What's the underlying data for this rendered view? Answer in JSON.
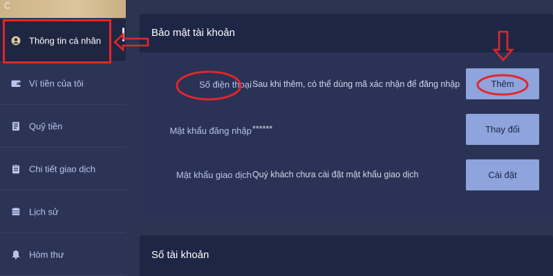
{
  "sidebar": {
    "items": [
      {
        "key": "personal-info",
        "label": "Thông tin cá nhân",
        "active": true,
        "icon": "user-icon"
      },
      {
        "key": "wallet",
        "label": "Ví tiền của tôi",
        "active": false,
        "icon": "wallet-icon"
      },
      {
        "key": "fund",
        "label": "Quỹ tiền",
        "active": false,
        "icon": "fund-icon"
      },
      {
        "key": "transactions",
        "label": "Chi tiết giao dịch",
        "active": false,
        "icon": "clipboard-icon"
      },
      {
        "key": "history",
        "label": "Lịch sử",
        "active": false,
        "icon": "coin-stack-icon"
      },
      {
        "key": "mailbox",
        "label": "Hòm thư",
        "active": false,
        "icon": "bell-icon"
      }
    ]
  },
  "security": {
    "title": "Bảo mật tài khoản",
    "rows": [
      {
        "label": "Số điện thoại",
        "value": "Sau khi thêm, có thể dùng mã xác nhận để đăng nhập",
        "button": "Thêm"
      },
      {
        "label": "Mật khẩu đăng nhập",
        "value": "******",
        "button": "Thay đổi"
      },
      {
        "label": "Mật khẩu giao dịch",
        "value": "Quý khách chưa cài đặt mật khẩu giao dịch",
        "button": "Cài đặt"
      }
    ]
  },
  "account": {
    "title": "Số tài khoản"
  },
  "colors": {
    "page_bg": "#2c3454",
    "card_header_bg": "#1e2645",
    "button_bg": "#8fa3dc",
    "label_text": "#b9c4ee",
    "annotation_red": "#e3262b"
  }
}
